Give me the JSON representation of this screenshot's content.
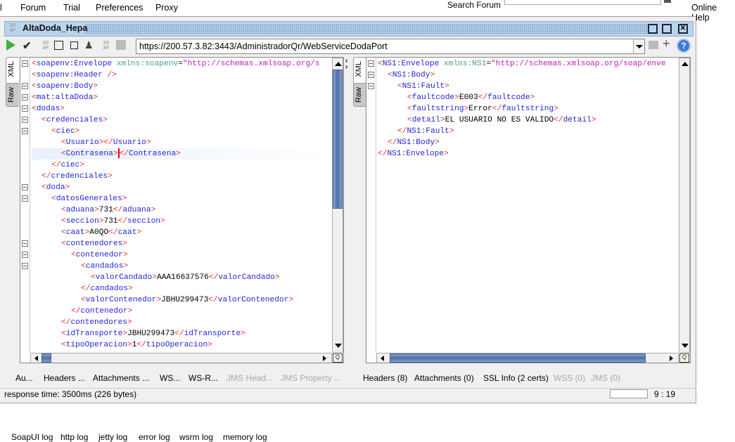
{
  "menu": {
    "items": [
      "l",
      "Forum",
      "Trial",
      "Preferences",
      "Proxy"
    ],
    "search_label": "Search Forum",
    "search_value": "",
    "online_help": "Online Help"
  },
  "window": {
    "title": "AltaDoda_Hepa",
    "soap_icon": "SO AP",
    "url": "https://200.57.3.82:3443/AdministradorQr/WebServiceDodaPort"
  },
  "toolbar_icons": [
    "play-icon",
    "submit-check-icon",
    "soap-icon",
    "refresh-icon",
    "stop-icon",
    "stamp-icon",
    "soap-icon",
    "square-icon"
  ],
  "request": {
    "tabs": [
      "XML",
      "Raw"
    ],
    "lines": [
      {
        "i": 0,
        "f": 1,
        "t": "<soapenv:Envelope xmlns:soapenv=\"http://schemas.xmlsoap.org/s"
      },
      {
        "i": 0,
        "f": 0,
        "t": "<soapenv:Header />"
      },
      {
        "i": 0,
        "f": 1,
        "t": "<soapenv:Body>"
      },
      {
        "i": 0,
        "f": 1,
        "t": "<mat:altaDoda>"
      },
      {
        "i": 0,
        "f": 1,
        "t": "<dodas>"
      },
      {
        "i": 1,
        "f": 1,
        "t": "<credenciales>"
      },
      {
        "i": 2,
        "f": 1,
        "t": "<ciec>"
      },
      {
        "i": 3,
        "f": 0,
        "t": "<Usuario></Usuario>"
      },
      {
        "i": 3,
        "f": 0,
        "t": "<Contrasena></Contrasena>",
        "cur": 1
      },
      {
        "i": 2,
        "f": 0,
        "t": "</ciec>"
      },
      {
        "i": 1,
        "f": 0,
        "t": "</credenciales>"
      },
      {
        "i": 1,
        "f": 1,
        "t": "<doda>"
      },
      {
        "i": 2,
        "f": 1,
        "t": "<datosGenerales>"
      },
      {
        "i": 3,
        "f": 0,
        "t": "<aduana>731</aduana>"
      },
      {
        "i": 3,
        "f": 0,
        "t": "<seccion>731</seccion>"
      },
      {
        "i": 3,
        "f": 0,
        "t": "<caat>A0QO</caat>"
      },
      {
        "i": 3,
        "f": 1,
        "t": "<contenedores>"
      },
      {
        "i": 4,
        "f": 1,
        "t": "<contenedor>"
      },
      {
        "i": 5,
        "f": 1,
        "t": "<candados>"
      },
      {
        "i": 6,
        "f": 0,
        "t": "<valorCandado>AAA16637576</valorCandado>"
      },
      {
        "i": 5,
        "f": 0,
        "t": "</candados>"
      },
      {
        "i": 5,
        "f": 0,
        "t": "<valorContenedor>JBHU299473</valorContenedor>"
      },
      {
        "i": 4,
        "f": 0,
        "t": "</contenedor>"
      },
      {
        "i": 3,
        "f": 0,
        "t": "</contenedores>"
      },
      {
        "i": 3,
        "f": 0,
        "t": "<idTransporte>JBHU299473</idTransporte>"
      },
      {
        "i": 3,
        "f": 0,
        "t": "<tipoOperacion>1</tipoOperacion>"
      }
    ],
    "bottom_tabs": [
      {
        "label": "Au...",
        "enabled": true
      },
      {
        "label": "Headers ...",
        "enabled": true
      },
      {
        "label": "Attachments ...",
        "enabled": true
      },
      {
        "label": "WS...",
        "enabled": true
      },
      {
        "label": "WS-R...",
        "enabled": true
      },
      {
        "label": "JMS Head...",
        "enabled": false
      },
      {
        "label": "JMS Property ...",
        "enabled": false
      }
    ]
  },
  "response": {
    "tabs": [
      "XML",
      "Raw"
    ],
    "lines": [
      {
        "i": 0,
        "f": 1,
        "t": "<NS1:Envelope xmlns:NS1=\"http://schemas.xmlsoap.org/soap/enve"
      },
      {
        "i": 1,
        "f": 1,
        "t": "<NS1:Body>"
      },
      {
        "i": 2,
        "f": 1,
        "t": "<NS1:Fault>"
      },
      {
        "i": 3,
        "f": 0,
        "t": "<faultcode>E003</faultcode>"
      },
      {
        "i": 3,
        "f": 0,
        "t": "<faultstring>Error</faultstring>"
      },
      {
        "i": 3,
        "f": 0,
        "t": "<detail>EL USUARIO NO ES VALIDO</detail>"
      },
      {
        "i": 2,
        "f": 0,
        "t": "</NS1:Fault>"
      },
      {
        "i": 1,
        "f": 0,
        "t": "</NS1:Body>"
      },
      {
        "i": 0,
        "f": 0,
        "t": "</NS1:Envelope>"
      }
    ],
    "bottom_tabs": [
      {
        "label": "Headers (8)",
        "enabled": true
      },
      {
        "label": "Attachments (0)",
        "enabled": true
      },
      {
        "label": "SSL Info (2 certs)",
        "enabled": true
      },
      {
        "label": "WSS (0)",
        "enabled": false
      },
      {
        "label": "JMS (0)",
        "enabled": false
      }
    ]
  },
  "status": {
    "response_time": "response time: 3500ms (226 bytes)",
    "cursor_pos": "9 : 19"
  },
  "log_tabs": [
    "SoapUI log",
    "http log",
    "jetty log",
    "error log",
    "wsrm log",
    "memory log"
  ],
  "colors": {
    "tag_bracket": "#ee2b2b",
    "tag_name": "#2424d8",
    "attr_name": "#4a9a9a",
    "attr_value": "#c818b4",
    "title_bar": "#b9d4ef",
    "scroll_thumb": "#4a6ea8"
  }
}
